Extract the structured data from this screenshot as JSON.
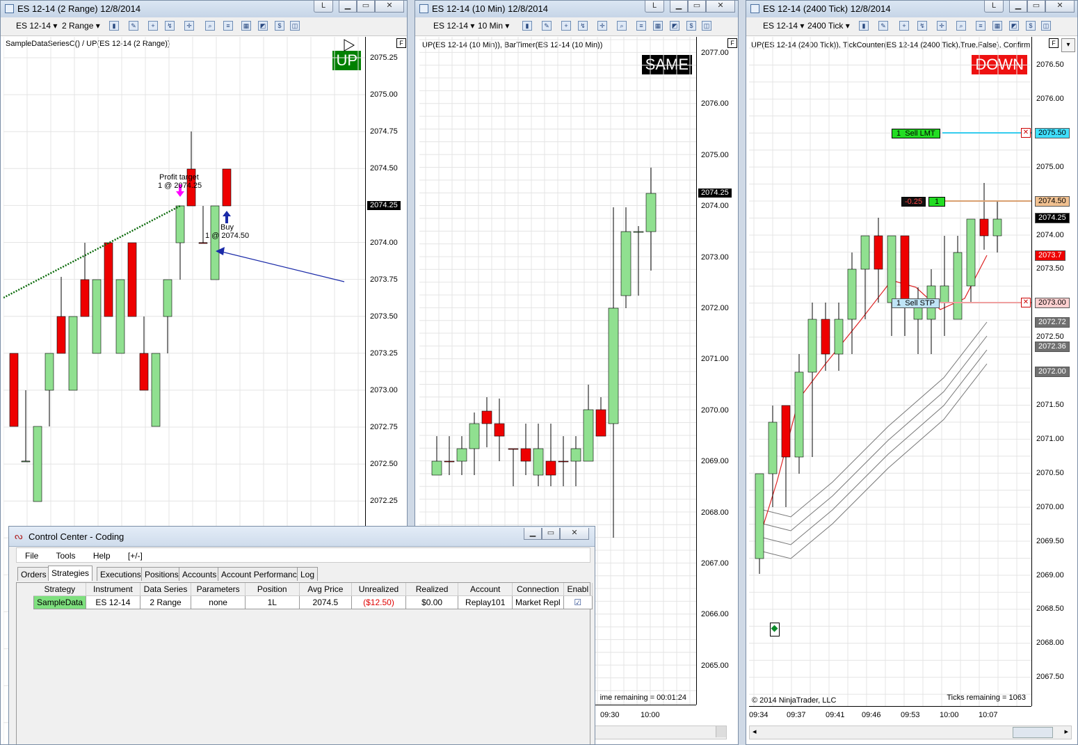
{
  "colors": {
    "up": "#90e090",
    "down": "#ee0000",
    "tag_up": "#008000",
    "tag_down": "#ee1111",
    "tag_same": "#000000"
  },
  "chart1": {
    "title": "ES 12-14 (2 Range)  12/8/2014",
    "toolbar": {
      "instrument": "ES 12-14",
      "interval": "2 Range"
    },
    "indicator_label": "SampleDataSeriesC() / UP(ES 12-14 (2 Range))",
    "tag": "UP",
    "y_ticks": [
      "2075.25",
      "2075.00",
      "2074.75",
      "2074.50",
      "2074.25",
      "2074.00",
      "2073.75",
      "2073.50",
      "2073.25",
      "2073.00",
      "2072.75",
      "2072.50",
      "2072.25"
    ],
    "current_price": "2074.25",
    "profit_target_line1": "Profit target",
    "profit_target_line2": "1 @ 2074.25",
    "buy_line1": "Buy",
    "buy_line2": "1 @ 2074.50",
    "corner_label": "F"
  },
  "chart2": {
    "title": "ES 12-14 (10 Min)  12/8/2014",
    "toolbar": {
      "instrument": "ES 12-14",
      "interval": "10 Min"
    },
    "indicator_label": "UP(ES 12-14 (10 Min)), BarTimer(ES 12-14 (10 Min))",
    "tag": "SAME",
    "y_ticks": [
      "2077.00",
      "2076.00",
      "2075.00",
      "2074.00",
      "2073.00",
      "2072.00",
      "2071.00",
      "2070.00",
      "2069.00",
      "2068.00",
      "2067.00",
      "2066.00",
      "2065.00"
    ],
    "current_price": "2074.25",
    "time_remaining": "ime remaining = 00:01:24",
    "x_ticks": [
      "09:30",
      "10:00"
    ],
    "corner_label": "F"
  },
  "chart3": {
    "title": "ES 12-14 (2400 Tick)  12/8/2014",
    "toolbar": {
      "instrument": "ES 12-14",
      "interval": "2400 Tick"
    },
    "indicator_label": "UP(ES 12-14 (2400 Tick)), TickCounter(ES 12-14 (2400 Tick),True,False), Confirm",
    "tag": "DOWN",
    "y_ticks": [
      "2076.50",
      "2076.00",
      "2075.50",
      "2075.00",
      "2074.50",
      "2074.00",
      "2073.50",
      "2073.00",
      "2072.50",
      "2072.00",
      "2071.50",
      "2071.00",
      "2070.50",
      "2070.00",
      "2069.50",
      "2069.00",
      "2068.50",
      "2068.00",
      "2067.50"
    ],
    "price_flags": [
      {
        "label": "2075.50",
        "bg": "#40e0ff"
      },
      {
        "label": "2074.50",
        "bg": "#f0c090"
      },
      {
        "label": "2074.25",
        "bg": "#000000",
        "fg": "#ffffff"
      },
      {
        "label": "2073.7",
        "bg": "#ee0000",
        "fg": "#ffffff"
      },
      {
        "label": "2073.00",
        "bg": "#ffd0d0"
      },
      {
        "label": "2072.72",
        "bg": "#707070",
        "fg": "#ffffff"
      },
      {
        "label": "2072.36",
        "bg": "#707070",
        "fg": "#ffffff"
      },
      {
        "label": "2072.00",
        "bg": "#707070",
        "fg": "#ffffff"
      }
    ],
    "sell_lmt_qty": "1",
    "sell_lmt_label": "Sell LMT",
    "pos_pnl": "-0.25",
    "pos_qty": "1",
    "sell_stp_qty": "1",
    "sell_stp_label": "Sell STP",
    "copyright": "© 2014 NinjaTrader, LLC",
    "ticks_remaining": "Ticks remaining = 1063",
    "x_ticks": [
      "09:34",
      "09:37",
      "09:41",
      "09:46",
      "09:53",
      "10:00",
      "10:07"
    ],
    "corner_label": "F"
  },
  "control_center": {
    "title": "Control Center - Coding",
    "menu": [
      "File",
      "Tools",
      "Help",
      "[+/-]"
    ],
    "tabs": [
      "Orders",
      "Strategies",
      "Executions",
      "Positions",
      "Accounts",
      "Account Performance",
      "Log"
    ],
    "selected_tab": "Strategies",
    "columns": [
      "Strategy",
      "Instrument",
      "Data Series",
      "Parameters",
      "Position",
      "Avg Price",
      "Unrealized",
      "Realized",
      "Account",
      "Connection",
      "Enabl"
    ],
    "rows": [
      [
        "SampleData",
        "ES 12-14",
        "2 Range",
        "none",
        "1L",
        "2074.5",
        "($12.50)",
        "$0.00",
        "Replay101",
        "Market Repl",
        "☑"
      ]
    ]
  },
  "window_buttons": {
    "layout": "L",
    "minimize": "▭",
    "restore": "⧉",
    "close": "✕"
  }
}
